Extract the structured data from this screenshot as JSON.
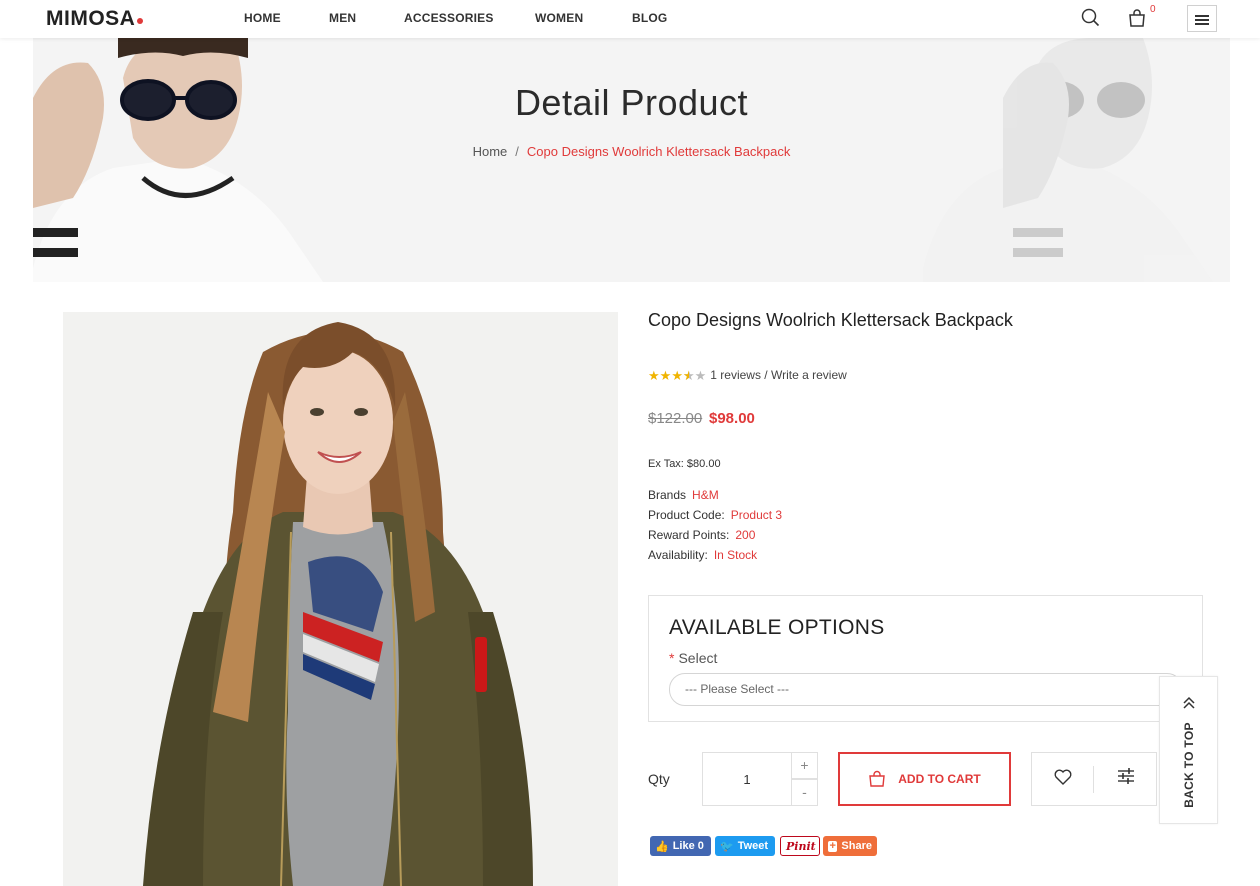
{
  "header": {
    "logo": "MIMOSA",
    "nav": [
      "HOME",
      "MEN",
      "ACCESSORIES",
      "WOMEN",
      "BLOG"
    ],
    "cart_count": "0"
  },
  "banner": {
    "title": "Detail Product",
    "breadcrumb": [
      "Home",
      "Copo Designs Woolrich Klettersack Backpack"
    ],
    "separator": "/"
  },
  "product": {
    "title": "Copo Designs Woolrich Klettersack Backpack",
    "rating": 3.5,
    "rating_max": 5,
    "reviews_text": "1 reviews",
    "write_review": "Write a review",
    "review_sep": " / ",
    "price_old": "$122.00",
    "price_new": "$98.00",
    "ex_tax": "Ex Tax: $80.00",
    "meta": [
      {
        "label": "Brands",
        "value": "H&M"
      },
      {
        "label": "Product Code:",
        "value": "Product 3"
      },
      {
        "label": "Reward Points:",
        "value": "200"
      },
      {
        "label": "Availability:",
        "value": "In Stock"
      }
    ]
  },
  "options": {
    "heading": "AVAILABLE OPTIONS",
    "required_mark": "*",
    "select_label": "Select",
    "select_value": "--- Please Select ---"
  },
  "purchase": {
    "qty_label": "Qty",
    "qty_value": "1",
    "plus": "+",
    "minus": "-",
    "add_to_cart": "ADD TO CART"
  },
  "back_to_top": "BACK TO TOP",
  "social": {
    "facebook": "Like 0",
    "twitter": "Tweet",
    "pinterest": "Pinit",
    "share": "Share"
  },
  "colors": {
    "accent": "#e03a3a",
    "star": "#f0b400",
    "facebook": "#4267b2",
    "twitter": "#1d9bf0",
    "pinterest": "#bd081c",
    "share": "#ef6e3a"
  }
}
